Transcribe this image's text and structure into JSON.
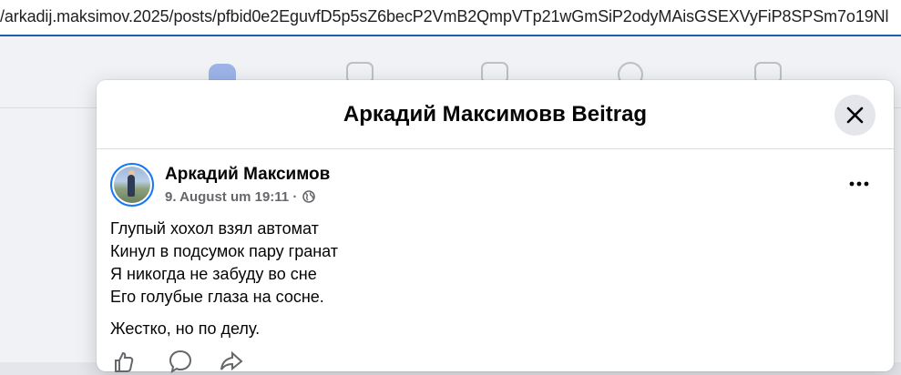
{
  "browser": {
    "url": "/arkadij.maksimov.2025/posts/pfbid0e2EguvfD5p5sZ6becP2VmB2QmpVTp21wGmSiP2odyMAisGSEXVyFiP8SPSm7o19Nl"
  },
  "modal": {
    "title": "Аркадий Максимовв Beitrag",
    "close_icon": "close-icon"
  },
  "post": {
    "author": "Аркадий Максимов",
    "timestamp": "9. August um 19:11 ·",
    "privacy_icon": "globe-icon",
    "more_icon": "more-horizontal-icon",
    "lines": [
      "Глупый хохол взял автомат",
      "Кинул в подсумок пару гранат",
      "Я никогда не забуду во сне",
      "Его голубые глаза на сосне."
    ],
    "comment": "Жестко, но по делу.",
    "action_icons": [
      "like-icon",
      "comment-icon",
      "share-icon"
    ]
  },
  "colors": {
    "accent": "#1877f2",
    "page_bg": "#f0f2f5",
    "text_secondary": "#65676b"
  }
}
